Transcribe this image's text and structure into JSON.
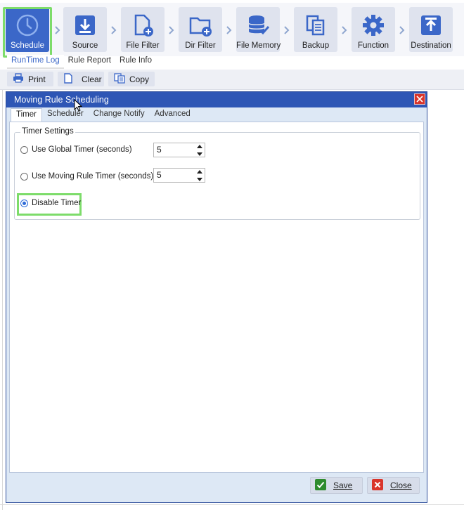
{
  "ribbon": {
    "steps": [
      {
        "label": "Schedule",
        "icon": "clock-icon",
        "active": true
      },
      {
        "label": "Source",
        "icon": "download-icon",
        "active": false
      },
      {
        "label": "File Filter",
        "icon": "file-filter-icon",
        "active": false
      },
      {
        "label": "Dir Filter",
        "icon": "folder-filter-icon",
        "active": false
      },
      {
        "label": "File Memory",
        "icon": "database-icon",
        "active": false
      },
      {
        "label": "Backup",
        "icon": "backup-copy-icon",
        "active": false
      },
      {
        "label": "Function",
        "icon": "gear-icon",
        "active": false
      },
      {
        "label": "Destination",
        "icon": "upload-icon",
        "active": false
      }
    ]
  },
  "subtabs": [
    "RunTime Log",
    "Rule Report",
    "Rule Info"
  ],
  "log_toolbar": {
    "print": "Print",
    "clear": "Clear",
    "copy": "Copy"
  },
  "dialog": {
    "title": "Moving Rule Scheduling",
    "tabs": [
      "Timer",
      "Scheduler",
      "Change Notify",
      "Advanced"
    ],
    "group_title": "Timer Settings",
    "options": [
      {
        "label": "Use Global Timer (seconds)",
        "value": "5",
        "checked": false
      },
      {
        "label": "Use Moving Rule Timer (seconds)",
        "value": "5",
        "checked": false
      },
      {
        "label": "Disable Timer",
        "checked": true
      }
    ],
    "save": "Save",
    "close": "Close"
  },
  "colors": {
    "accent": "#3b67c8",
    "titlebar": "#2e56b5",
    "highlight": "#7ddc6a",
    "close_red": "#d9352b"
  }
}
